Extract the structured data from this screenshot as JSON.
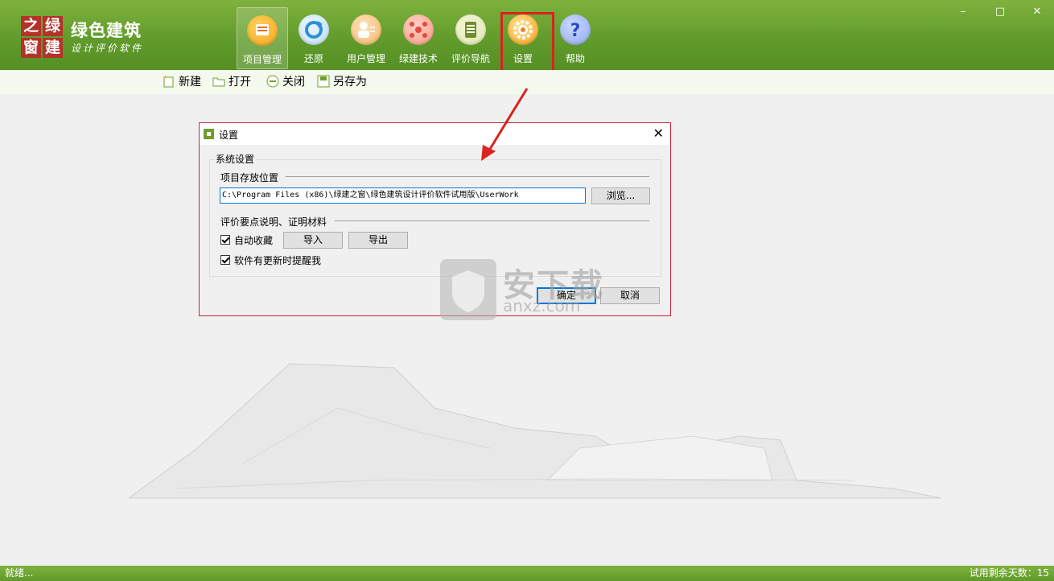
{
  "app": {
    "logo_chars": [
      "之",
      "绿",
      "窗",
      "建"
    ],
    "title": "绿色建筑",
    "subtitle": "设计评价软件"
  },
  "nav": [
    {
      "label": "项目管理",
      "icon": "project-icon",
      "color": "#f6a31b"
    },
    {
      "label": "还原",
      "icon": "restore-icon",
      "color": "#2d8fd8"
    },
    {
      "label": "用户管理",
      "icon": "user-icon",
      "color": "#f39a3b"
    },
    {
      "label": "绿建技术",
      "icon": "tech-icon",
      "color": "#e8473b"
    },
    {
      "label": "评价导航",
      "icon": "guide-icon",
      "color": "#6f8f2a"
    },
    {
      "label": "设置",
      "icon": "gear-icon",
      "color": "#f08a1c"
    },
    {
      "label": "帮助",
      "icon": "help-icon",
      "color": "#4a6fd8"
    }
  ],
  "window_controls": {
    "minimize": "–",
    "maximize": "□",
    "close": "✕"
  },
  "toolbar": {
    "new": "新建",
    "open": "打开",
    "close": "关闭",
    "save_as": "另存为"
  },
  "dialog": {
    "title": "设置",
    "close_glyph": "✕",
    "group_system": "系统设置",
    "section_location": "项目存放位置",
    "path_value": "C:\\Program Files (x86)\\绿建之窗\\绿色建筑设计评价软件试用版\\UserWork",
    "browse": "浏览...",
    "section_materials": "评价要点说明、证明材料",
    "auto_collect": "自动收藏",
    "import": "导入",
    "export": "导出",
    "update_notify": "软件有更新时提醒我",
    "ok": "确定",
    "cancel": "取消"
  },
  "watermark": {
    "main": "安下载",
    "sub": "anxz.com"
  },
  "status": {
    "left": "就绪...",
    "right": "试用剩余天数：15"
  },
  "colors": {
    "header_green": "#5f9a2a",
    "highlight_red": "#d9231f",
    "logo_red": "#b5322a"
  }
}
